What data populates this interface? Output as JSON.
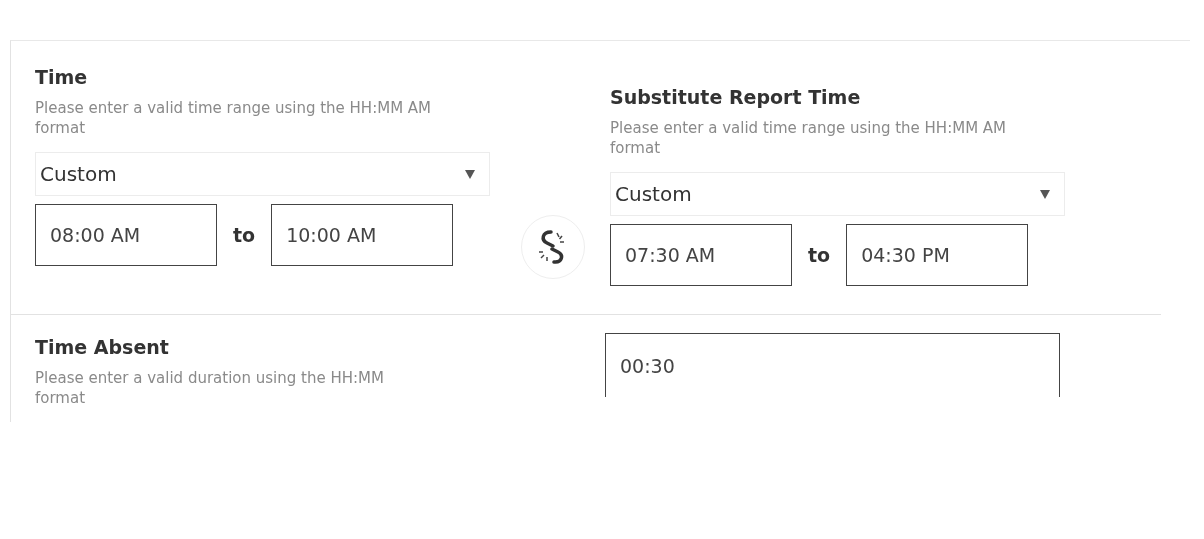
{
  "time": {
    "label": "Time",
    "hint": "Please enter a valid time range using the HH:MM AM format",
    "mode": "Custom",
    "from": "08:00 AM",
    "separator": "to",
    "until": "10:00 AM"
  },
  "link": {
    "linked": false
  },
  "substitute_report_time": {
    "label": "Substitute Report Time",
    "hint": "Please enter a valid time range using the HH:MM AM format",
    "mode": "Custom",
    "from": "07:30 AM",
    "separator": "to",
    "until": "04:30 PM"
  },
  "time_absent": {
    "label": "Time Absent",
    "hint": "Please enter a valid duration using the HH:MM format",
    "value": "00:30"
  }
}
